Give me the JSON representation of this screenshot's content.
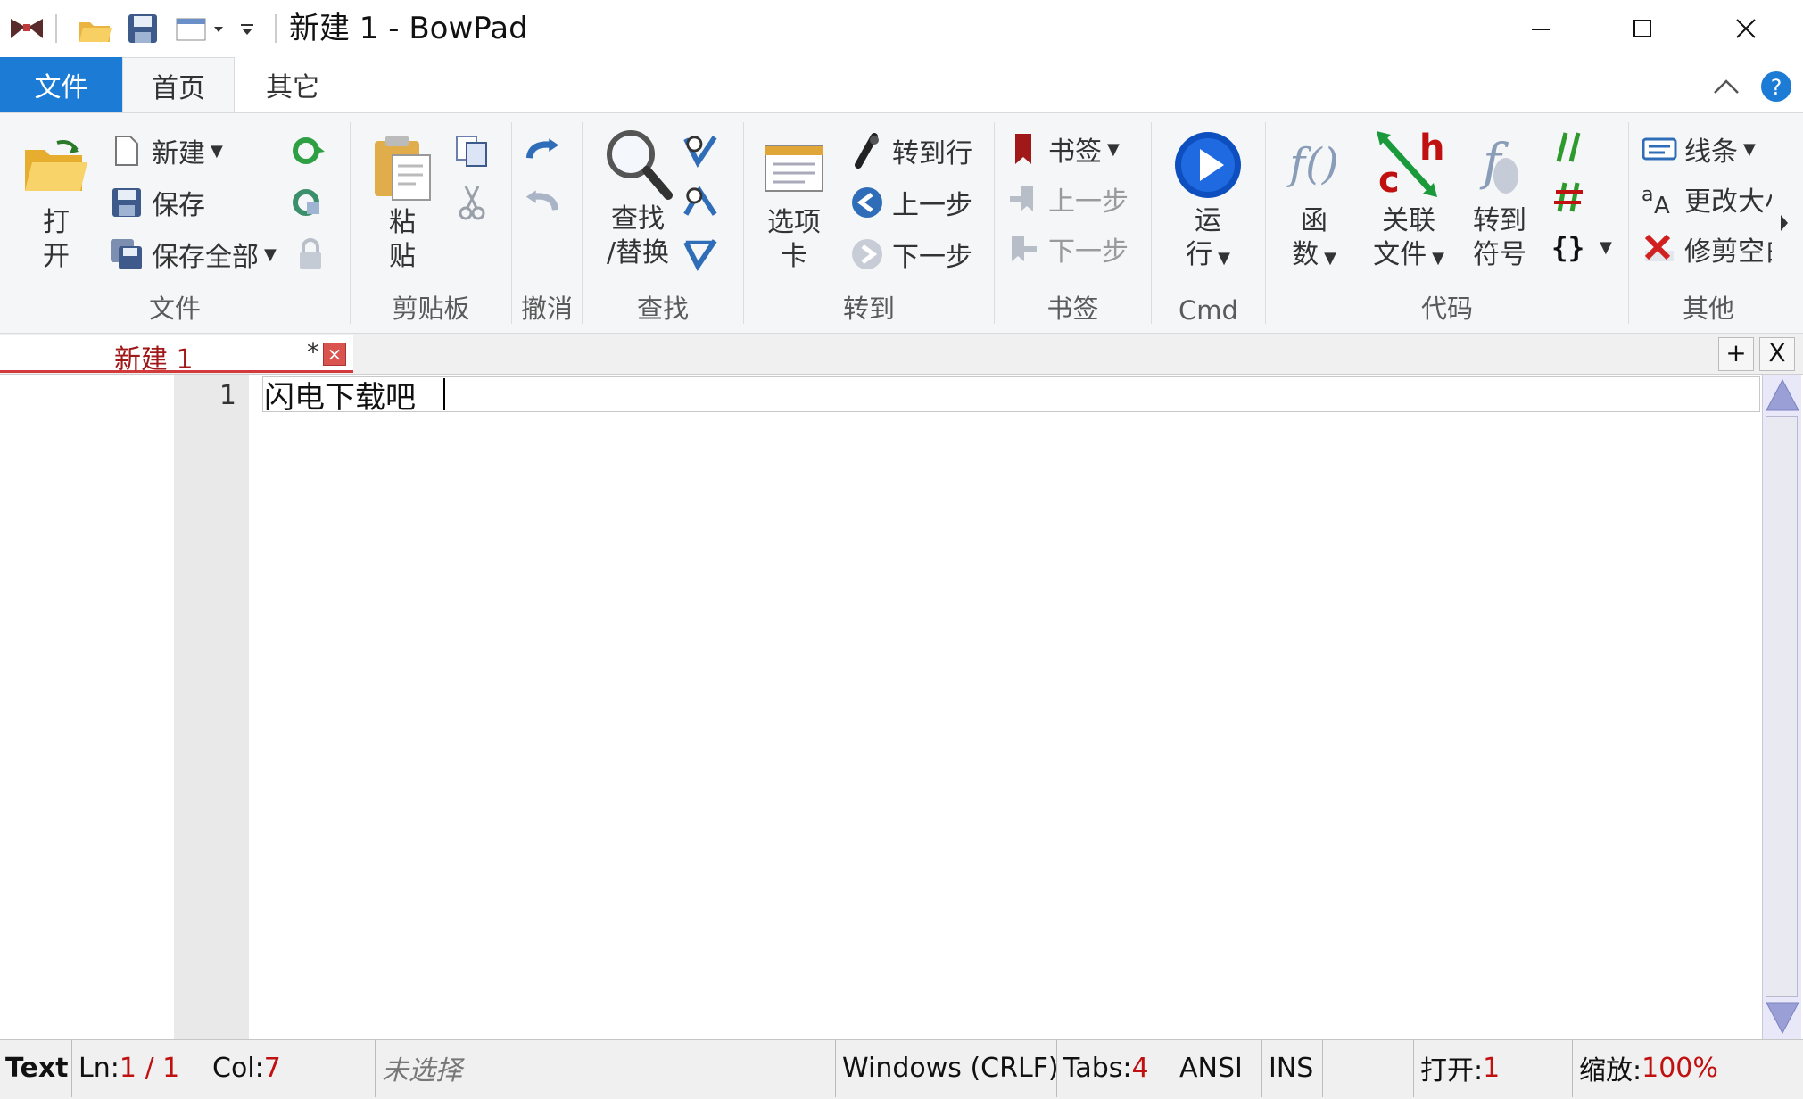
{
  "window": {
    "title": "新建 1 - BowPad"
  },
  "quick_access": {
    "icons": [
      "bowpad-logo-icon",
      "open-folder-icon",
      "save-icon",
      "tabs-menu-icon",
      "customize-qat-icon"
    ]
  },
  "ribbon_tabs": [
    {
      "label": "文件"
    },
    {
      "label": "首页"
    },
    {
      "label": "其它"
    }
  ],
  "groups": {
    "file": {
      "label": "文件",
      "open": {
        "l1": "打",
        "l2": "开"
      },
      "new": "新建",
      "save": "保存",
      "save_all": "保存全部"
    },
    "clipboard": {
      "label": "剪贴板",
      "paste": {
        "l1": "粘",
        "l2": "贴"
      }
    },
    "undo": {
      "label": "撤消"
    },
    "find": {
      "label": "查找",
      "find_replace": {
        "l1": "查找",
        "l2": "/替换"
      }
    },
    "goto": {
      "label": "转到",
      "tabs": {
        "l1": "选项",
        "l2": "卡"
      },
      "goto_line": "转到行",
      "prev": "上一步",
      "next": "下一步"
    },
    "bookmarks": {
      "label": "书签",
      "bookmark": "书签",
      "prev": "上一步",
      "next": "下一步"
    },
    "cmd": {
      "label": "Cmd",
      "run": {
        "l1": "运",
        "l2": "行"
      }
    },
    "code": {
      "label": "代码",
      "functions": {
        "l1": "函",
        "l2": "数"
      },
      "related": {
        "l1": "关联",
        "l2": "文件"
      },
      "goto_symbol": {
        "l1": "转到",
        "l2": "符号"
      }
    },
    "other": {
      "label": "其他",
      "lines": "线条",
      "change_case": "更改大小写",
      "trim": "修剪空白"
    }
  },
  "doc_tabs": {
    "active_label": "新建 1",
    "modified_marker": "*",
    "close_glyph": "×",
    "add_label": "+",
    "close_all_label": "X"
  },
  "editor": {
    "line_number": "1",
    "content": "闪电下载吧"
  },
  "status": {
    "lang": "Text",
    "ln_label": "Ln: ",
    "ln_value": "1 / 1",
    "col_label": "Col: ",
    "col_value": "7",
    "selection": "未选择",
    "eol": "Windows (CRLF)",
    "tabs_label": "Tabs: ",
    "tabs_value": "4",
    "encoding": "ANSI",
    "ins": "INS",
    "open_label": "打开: ",
    "open_value": "1",
    "zoom_label": "缩放: ",
    "zoom_value": "100%"
  },
  "colors": {
    "accent": "#1c7bd4",
    "ribbon_bg": "#f5f6f7",
    "tab_red": "#d23b3b",
    "status_value": "#c01010"
  }
}
